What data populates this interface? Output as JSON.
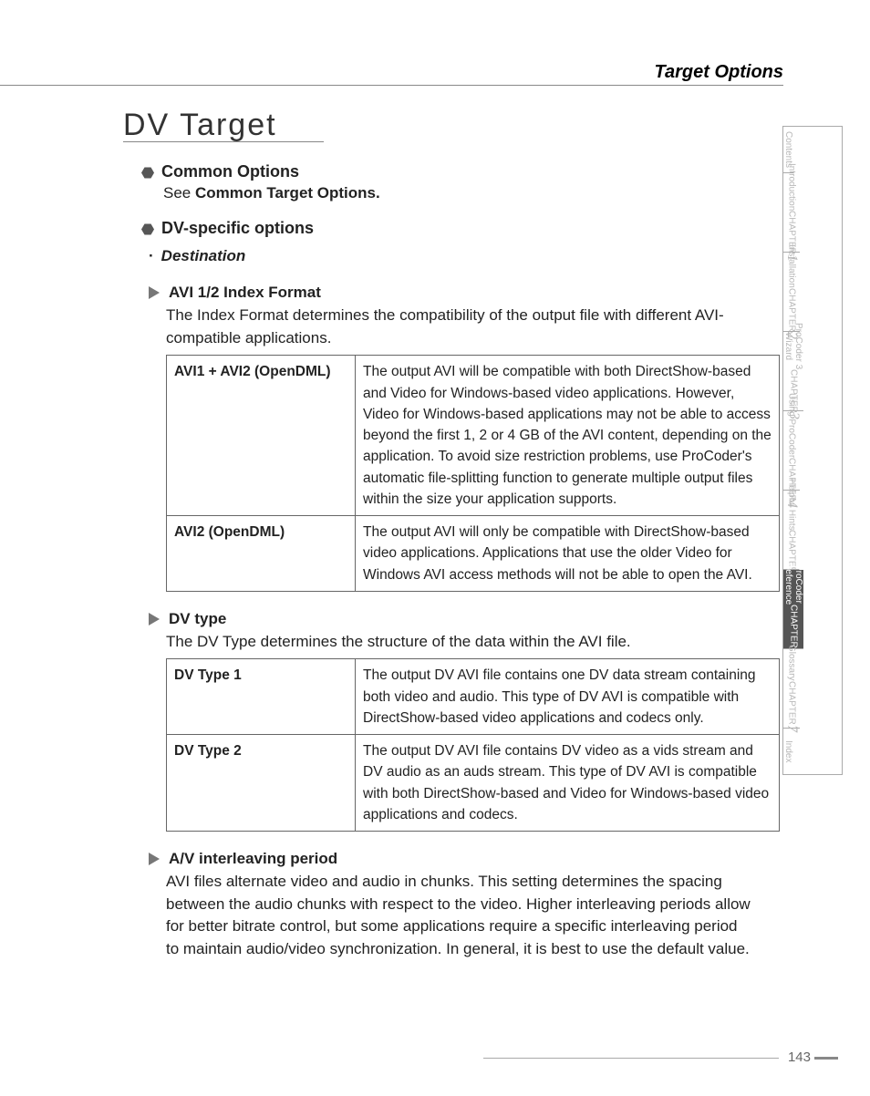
{
  "header": {
    "title": "Target Options"
  },
  "section": {
    "title": "DV Target"
  },
  "blocks": {
    "common_options": {
      "heading": "Common Options",
      "text_prefix": "See ",
      "text_bold": "Common Target Options."
    },
    "dv_specific": {
      "heading": "DV-specific options"
    },
    "destination": {
      "label": "Destination"
    },
    "avi_index": {
      "heading": "AVI 1/2 Index Format",
      "body": "The Index Format determines the compatibility of the output file with different AVI-compatible applications.",
      "rows": [
        {
          "k": "AVI1 + AVI2 (OpenDML)",
          "v": "The output AVI will be compatible with both DirectShow-based and Video for Windows-based video applications. However, Video for Windows-based applications may not be able to access beyond the first 1, 2 or 4 GB of the AVI content, depending on the application. To avoid size restriction problems, use ProCoder's automatic file-splitting function to generate multiple output files within the size your application supports."
        },
        {
          "k": "AVI2 (OpenDML)",
          "v": "The output AVI will only be compatible with DirectShow-based video applications. Applications that use the older Video for Windows AVI access methods will not be able to open the AVI."
        }
      ]
    },
    "dv_type": {
      "heading": "DV type",
      "body": "The DV Type determines the structure of the data within the AVI file.",
      "rows": [
        {
          "k": "DV Type 1",
          "v": "The output DV AVI file contains one DV data stream containing both video and audio. This type of DV AVI is compatible with DirectShow-based video applications and codecs only."
        },
        {
          "k": "DV Type 2",
          "v": "The output DV AVI file contains DV video as a vids stream and DV audio as an auds stream. This type of DV AVI is compatible with both DirectShow-based and Video for Windows-based video applications and codecs."
        }
      ]
    },
    "av_interleave": {
      "heading": "A/V interleaving period",
      "body": "AVI files alternate video and audio in chunks. This setting determines the spacing between the audio chunks with respect to the video. Higher interleaving periods allow for better bitrate control, but some applications require a specific interleaving period to maintain audio/video synchronization. In general, it is best to use the default value."
    }
  },
  "sidebar": {
    "items": [
      {
        "sub": "Contents",
        "short": true
      },
      {
        "chapter": "CHAPTER",
        "num": "1",
        "sub": "Introduction"
      },
      {
        "chapter": "CHAPTER",
        "num": "2",
        "sub": "Installation"
      },
      {
        "chapter": "CHAPTER",
        "num": "3",
        "sub": "ProCoder 3\nWizard"
      },
      {
        "chapter": "CHAPTER",
        "num": "4",
        "sub": "Using ProCoder"
      },
      {
        "chapter": "CHAPTER",
        "num": "5",
        "sub": "Helpful Hints"
      },
      {
        "chapter": "CHAPTER",
        "num": "6",
        "sub": "ProCoder\nReference",
        "active": true
      },
      {
        "chapter": "CHAPTER",
        "num": "7",
        "sub": "Glossary"
      },
      {
        "sub": "Index",
        "short": true
      }
    ]
  },
  "footer": {
    "page": "143"
  }
}
